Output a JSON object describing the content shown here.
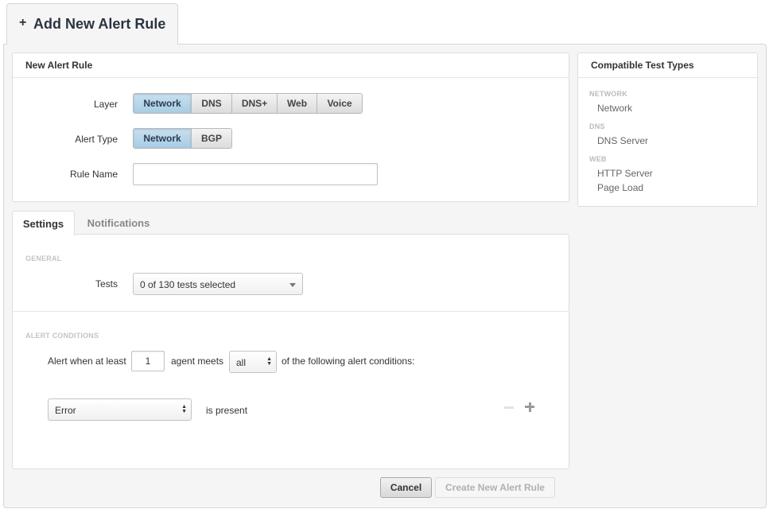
{
  "page_tab": {
    "icon": "plus-icon",
    "title": "Add New Alert Rule"
  },
  "new_rule": {
    "heading": "New Alert Rule",
    "layer_label": "Layer",
    "layer_options": [
      "Network",
      "DNS",
      "DNS+",
      "Web",
      "Voice"
    ],
    "layer_selected": "Network",
    "alert_type_label": "Alert Type",
    "alert_type_options": [
      "Network",
      "BGP"
    ],
    "alert_type_selected": "Network",
    "rule_name_label": "Rule Name",
    "rule_name_value": ""
  },
  "compatible": {
    "heading": "Compatible Test Types",
    "groups": [
      {
        "category": "NETWORK",
        "items": [
          "Network"
        ]
      },
      {
        "category": "DNS",
        "items": [
          "DNS Server"
        ]
      },
      {
        "category": "WEB",
        "items": [
          "HTTP Server",
          "Page Load"
        ]
      }
    ]
  },
  "tabs": [
    {
      "label": "Settings",
      "active": true
    },
    {
      "label": "Notifications",
      "active": false
    }
  ],
  "settings": {
    "general_title": "GENERAL",
    "tests_label": "Tests",
    "tests_value": "0 of 130 tests selected",
    "conditions_title": "ALERT CONDITIONS",
    "alert_when_text": "Alert when at least",
    "agent_count": "1",
    "agent_meets_text": "agent meets",
    "match_value": "all",
    "following_text": "of the following alert conditions:",
    "condition_value": "Error",
    "is_present_text": "is present",
    "remove_icon": "minus-icon",
    "add_icon": "plus-icon"
  },
  "actions": {
    "cancel": "Cancel",
    "create": "Create New Alert Rule"
  },
  "colors": {
    "active_segment": "#b3d3e8",
    "page_background": "#f5f5f5",
    "panel_border": "#dedede"
  }
}
